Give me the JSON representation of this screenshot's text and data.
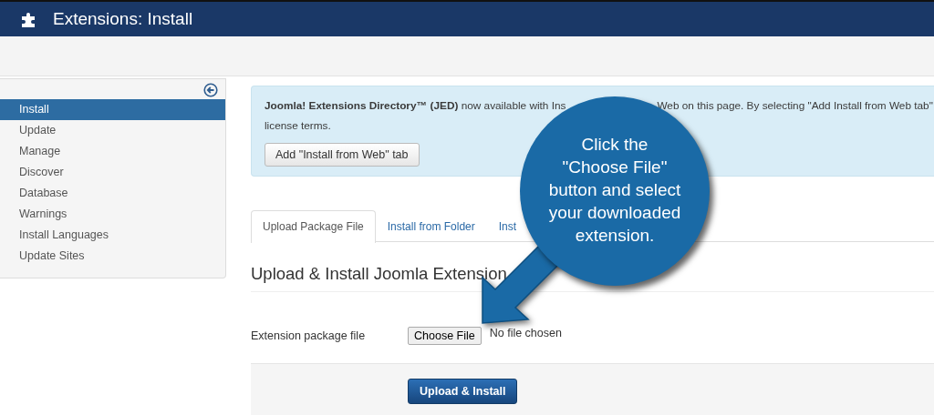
{
  "header": {
    "title": "Extensions: Install"
  },
  "sidebar": {
    "items": [
      {
        "label": "Install",
        "selected": true
      },
      {
        "label": "Update",
        "selected": false
      },
      {
        "label": "Manage",
        "selected": false
      },
      {
        "label": "Discover",
        "selected": false
      },
      {
        "label": "Database",
        "selected": false
      },
      {
        "label": "Warnings",
        "selected": false
      },
      {
        "label": "Install Languages",
        "selected": false
      },
      {
        "label": "Update Sites",
        "selected": false
      }
    ]
  },
  "notice": {
    "text_before": "**Joomla! Extensions Directory™ (JED)** now available with Ins",
    "text_after": "Web on this page. By selecting \"Add Install from Web tab\"",
    "line_2": "license terms.",
    "button": "Add \"Install from Web\" tab"
  },
  "tabs": [
    {
      "label": "Upload Package File",
      "selected": true
    },
    {
      "label": "Install from Folder",
      "selected": false
    },
    {
      "label": "Inst",
      "selected": false
    }
  ],
  "form": {
    "heading": "Upload & Install Joomla Extension",
    "field_label": "Extension package file",
    "file_button": "Choose File",
    "file_status": "No file chosen",
    "submit": "Upload & Install"
  },
  "callout": {
    "lines": [
      "Click the",
      "\"Choose File\"",
      "button and select",
      "your downloaded",
      "extension."
    ]
  }
}
